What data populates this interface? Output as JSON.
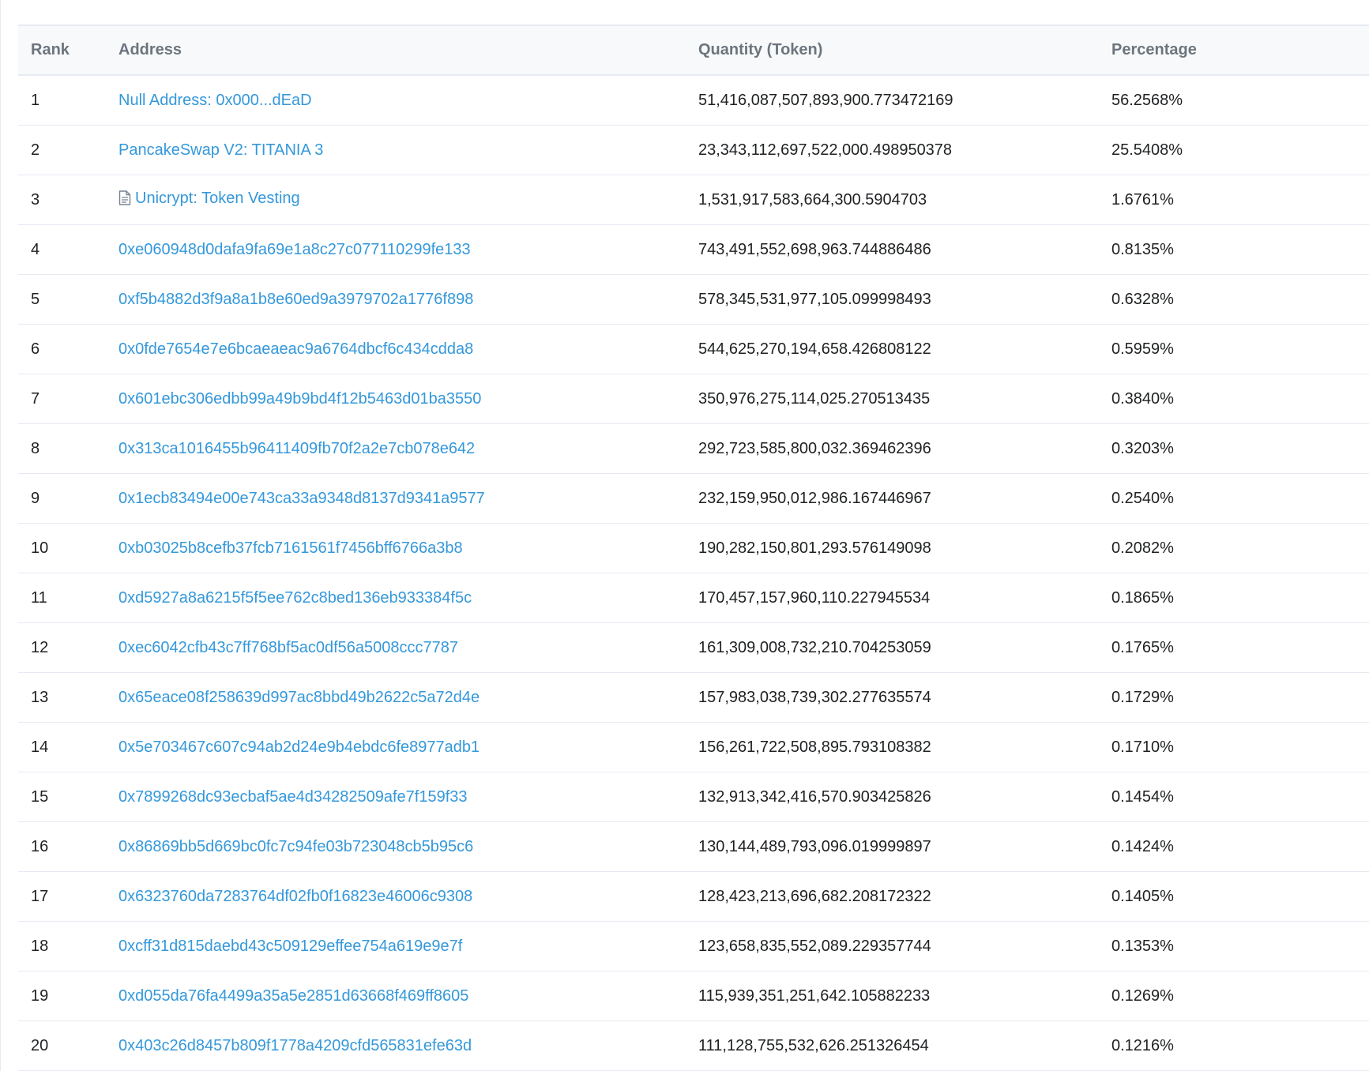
{
  "table": {
    "headers": {
      "rank": "Rank",
      "address": "Address",
      "quantity": "Quantity (Token)",
      "percentage": "Percentage"
    },
    "rows": [
      {
        "rank": "1",
        "address": "Null Address: 0x000...dEaD",
        "quantity": "51,416,087,507,893,900.773472169",
        "percentage": "56.2568%",
        "icon": ""
      },
      {
        "rank": "2",
        "address": "PancakeSwap V2: TITANIA 3",
        "quantity": "23,343,112,697,522,000.498950378",
        "percentage": "25.5408%",
        "icon": ""
      },
      {
        "rank": "3",
        "address": "Unicrypt: Token Vesting",
        "quantity": "1,531,917,583,664,300.5904703",
        "percentage": "1.6761%",
        "icon": "contract-document-icon"
      },
      {
        "rank": "4",
        "address": "0xe060948d0dafa9fa69e1a8c27c077110299fe133",
        "quantity": "743,491,552,698,963.744886486",
        "percentage": "0.8135%",
        "icon": ""
      },
      {
        "rank": "5",
        "address": "0xf5b4882d3f9a8a1b8e60ed9a3979702a1776f898",
        "quantity": "578,345,531,977,105.099998493",
        "percentage": "0.6328%",
        "icon": ""
      },
      {
        "rank": "6",
        "address": "0x0fde7654e7e6bcaeaeac9a6764dbcf6c434cdda8",
        "quantity": "544,625,270,194,658.426808122",
        "percentage": "0.5959%",
        "icon": ""
      },
      {
        "rank": "7",
        "address": "0x601ebc306edbb99a49b9bd4f12b5463d01ba3550",
        "quantity": "350,976,275,114,025.270513435",
        "percentage": "0.3840%",
        "icon": ""
      },
      {
        "rank": "8",
        "address": "0x313ca1016455b96411409fb70f2a2e7cb078e642",
        "quantity": "292,723,585,800,032.369462396",
        "percentage": "0.3203%",
        "icon": ""
      },
      {
        "rank": "9",
        "address": "0x1ecb83494e00e743ca33a9348d8137d9341a9577",
        "quantity": "232,159,950,012,986.167446967",
        "percentage": "0.2540%",
        "icon": ""
      },
      {
        "rank": "10",
        "address": "0xb03025b8cefb37fcb7161561f7456bff6766a3b8",
        "quantity": "190,282,150,801,293.576149098",
        "percentage": "0.2082%",
        "icon": ""
      },
      {
        "rank": "11",
        "address": "0xd5927a8a6215f5f5ee762c8bed136eb933384f5c",
        "quantity": "170,457,157,960,110.227945534",
        "percentage": "0.1865%",
        "icon": ""
      },
      {
        "rank": "12",
        "address": "0xec6042cfb43c7ff768bf5ac0df56a5008ccc7787",
        "quantity": "161,309,008,732,210.704253059",
        "percentage": "0.1765%",
        "icon": ""
      },
      {
        "rank": "13",
        "address": "0x65eace08f258639d997ac8bbd49b2622c5a72d4e",
        "quantity": "157,983,038,739,302.277635574",
        "percentage": "0.1729%",
        "icon": ""
      },
      {
        "rank": "14",
        "address": "0x5e703467c607c94ab2d24e9b4ebdc6fe8977adb1",
        "quantity": "156,261,722,508,895.793108382",
        "percentage": "0.1710%",
        "icon": ""
      },
      {
        "rank": "15",
        "address": "0x7899268dc93ecbaf5ae4d34282509afe7f159f33",
        "quantity": "132,913,342,416,570.903425826",
        "percentage": "0.1454%",
        "icon": ""
      },
      {
        "rank": "16",
        "address": "0x86869bb5d669bc0fc7c94fe03b723048cb5b95c6",
        "quantity": "130,144,489,793,096.019999897",
        "percentage": "0.1424%",
        "icon": ""
      },
      {
        "rank": "17",
        "address": "0x6323760da7283764df02fb0f16823e46006c9308",
        "quantity": "128,423,213,696,682.208172322",
        "percentage": "0.1405%",
        "icon": ""
      },
      {
        "rank": "18",
        "address": "0xcff31d815daebd43c509129effee754a619e9e7f",
        "quantity": "123,658,835,552,089.229357744",
        "percentage": "0.1353%",
        "icon": ""
      },
      {
        "rank": "19",
        "address": "0xd055da76fa4499a35a5e2851d63668f469ff8605",
        "quantity": "115,939,351,251,642.105882233",
        "percentage": "0.1269%",
        "icon": ""
      },
      {
        "rank": "20",
        "address": "0x403c26d8457b809f1778a4209cfd565831efe63d",
        "quantity": "111,128,755,532,626.251326454",
        "percentage": "0.1216%",
        "icon": ""
      }
    ]
  },
  "colors": {
    "link": "#3498db",
    "header_text": "#6c757e",
    "body_text": "#1e2022",
    "border": "#e7eaf3",
    "header_bg": "#f8f9fa"
  }
}
